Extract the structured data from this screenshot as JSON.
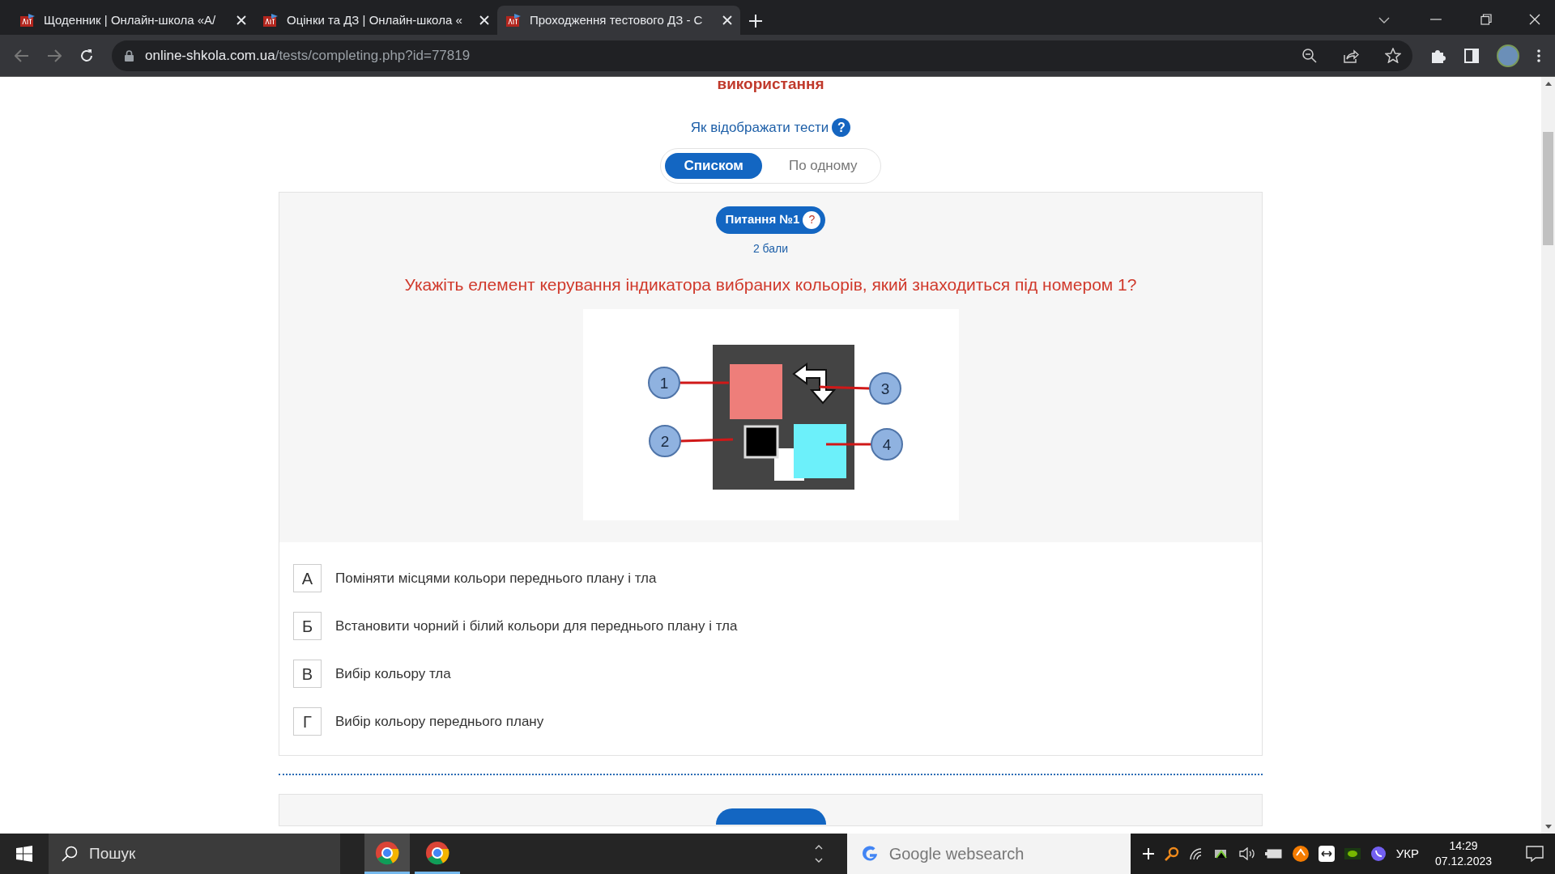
{
  "browser": {
    "tabs": [
      {
        "title": "Щоденник | Онлайн-школа «А/",
        "selected": false
      },
      {
        "title": "Оцінки та ДЗ | Онлайн-школа «",
        "selected": false
      },
      {
        "title": "Проходження тестового ДЗ - С",
        "selected": true
      }
    ],
    "url_host": "online-shkola.com.ua",
    "url_path": "/tests/completing.php?id=77819"
  },
  "page": {
    "heading_tail": "використання",
    "display_label": "Як відображати тести",
    "help_mark": "?",
    "display_modes": [
      {
        "label": "Списком",
        "selected": true
      },
      {
        "label": "По одному",
        "selected": false
      }
    ],
    "question": {
      "badge": "Питання №1",
      "badge_mark": "?",
      "points": "2 бали",
      "text": "Укажіть елемент керування індикатора вибраних кольорів, який знаходиться під номером 1?",
      "callouts": [
        "1",
        "2",
        "3",
        "4"
      ],
      "options": [
        {
          "letter": "А",
          "text": "Поміняти місцями кольори переднього плану і тла"
        },
        {
          "letter": "Б",
          "text": "Встановити чорний і білий кольори для переднього плану і тла"
        },
        {
          "letter": "В",
          "text": "Вибір кольору тла"
        },
        {
          "letter": "Г",
          "text": "Вибір кольору переднього плану"
        }
      ]
    }
  },
  "taskbar": {
    "search": "Пошук",
    "websearch": "Google websearch",
    "language": "УКР",
    "time": "14:29",
    "date": "07.12.2023"
  }
}
